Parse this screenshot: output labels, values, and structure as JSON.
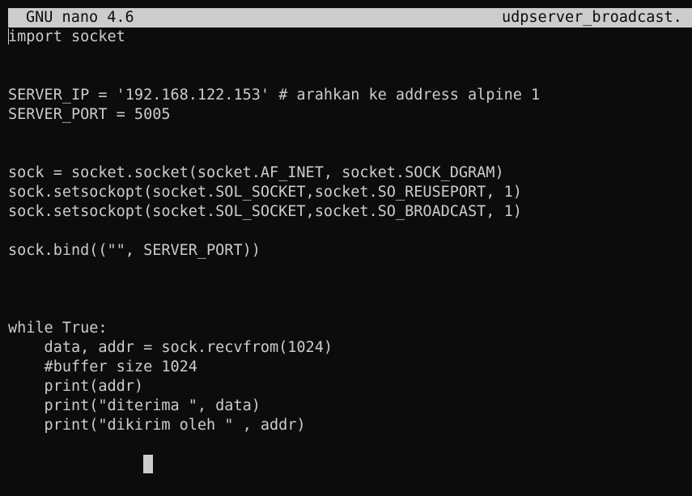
{
  "titlebar": {
    "app": "GNU nano 4.6",
    "filename": "udpserver_broadcast."
  },
  "code": [
    "import socket",
    "",
    "",
    "SERVER_IP = '192.168.122.153' # arahkan ke address alpine 1",
    "SERVER_PORT = 5005",
    "",
    "",
    "sock = socket.socket(socket.AF_INET, socket.SOCK_DGRAM)",
    "sock.setsockopt(socket.SOL_SOCKET,socket.SO_REUSEPORT, 1)",
    "sock.setsockopt(socket.SOL_SOCKET,socket.SO_BROADCAST, 1)",
    "",
    "sock.bind((\"\", SERVER_PORT))",
    "",
    "",
    "",
    "while True:",
    "    data, addr = sock.recvfrom(1024)",
    "    #buffer size 1024",
    "    print(addr)",
    "    print(\"diterima \", data)",
    "    print(\"dikirim oleh \" , addr)"
  ]
}
